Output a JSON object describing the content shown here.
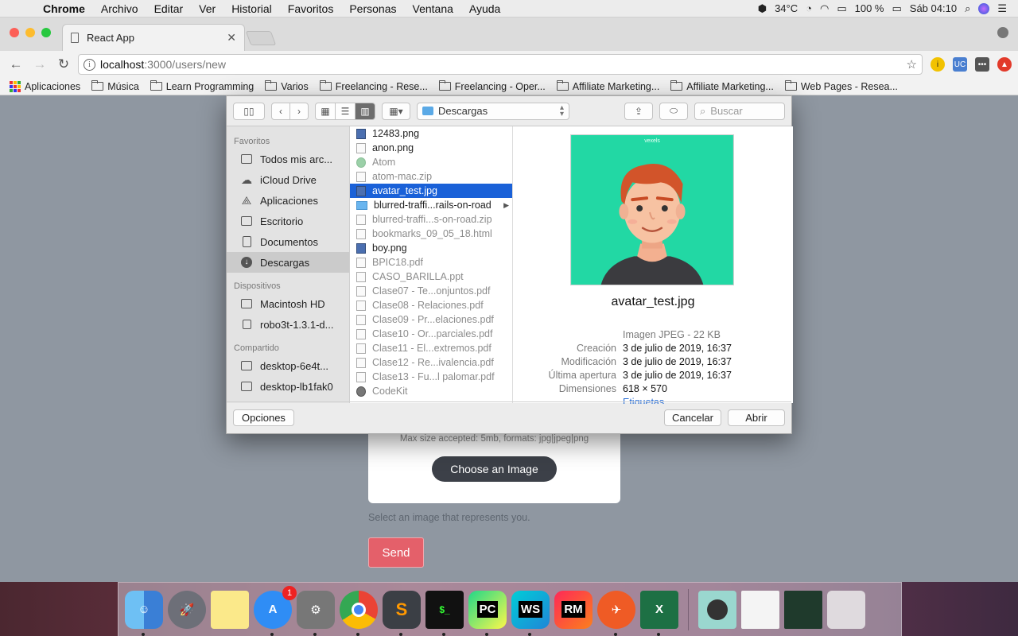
{
  "menubar": {
    "items": [
      "Chrome",
      "Archivo",
      "Editar",
      "Ver",
      "Historial",
      "Favoritos",
      "Personas",
      "Ventana",
      "Ayuda"
    ],
    "temperature": "34°C",
    "battery": "100 %",
    "clock": "Sáb 04:10"
  },
  "browser": {
    "tab_title": "React App",
    "url_host": "localhost",
    "url_path": ":3000/users/new",
    "extension_uc": "UC",
    "bookmarks": [
      "Aplicaciones",
      "Música",
      "Learn Programming",
      "Varios",
      "Freelancing - Rese...",
      "Freelancing - Oper...",
      "Affiliate Marketing...",
      "Affiliate Marketing...",
      "Web Pages - Resea..."
    ]
  },
  "page": {
    "card_note": "Max size accepted: 5mb, formats: jpg|jpeg|png",
    "choose_label": "Choose an Image",
    "hint": "Select an image that represents you.",
    "send_label": "Send"
  },
  "dialog": {
    "location": "Descargas",
    "search_placeholder": "Buscar",
    "sidebar": {
      "favoritos_label": "Favoritos",
      "favoritos": [
        "Todos mis arc...",
        "iCloud Drive",
        "Aplicaciones",
        "Escritorio",
        "Documentos",
        "Descargas"
      ],
      "dispositivos_label": "Dispositivos",
      "dispositivos": [
        "Macintosh HD",
        "robo3t-1.3.1-d..."
      ],
      "compartido_label": "Compartido",
      "compartido": [
        "desktop-6e4t...",
        "desktop-lb1fak0"
      ]
    },
    "files": [
      {
        "name": "12483.png",
        "kind": "img",
        "dim": false
      },
      {
        "name": "anon.png",
        "kind": "doc",
        "dim": false
      },
      {
        "name": "Atom",
        "kind": "atom",
        "dim": true
      },
      {
        "name": "atom-mac.zip",
        "kind": "doc",
        "dim": true
      },
      {
        "name": "avatar_test.jpg",
        "kind": "img",
        "dim": false,
        "selected": true
      },
      {
        "name": "blurred-traffi...rails-on-road",
        "kind": "folder",
        "dim": false,
        "chevron": true
      },
      {
        "name": "blurred-traffi...s-on-road.zip",
        "kind": "doc",
        "dim": true
      },
      {
        "name": "bookmarks_09_05_18.html",
        "kind": "doc",
        "dim": true
      },
      {
        "name": "boy.png",
        "kind": "img",
        "dim": false
      },
      {
        "name": "BPIC18.pdf",
        "kind": "doc",
        "dim": true
      },
      {
        "name": "CASO_BARILLA.ppt",
        "kind": "doc",
        "dim": true
      },
      {
        "name": "Clase07 - Te...onjuntos.pdf",
        "kind": "doc",
        "dim": true
      },
      {
        "name": "Clase08 - Relaciones.pdf",
        "kind": "doc",
        "dim": true
      },
      {
        "name": "Clase09 - Pr...elaciones.pdf",
        "kind": "doc",
        "dim": true
      },
      {
        "name": "Clase10 - Or...parciales.pdf",
        "kind": "doc",
        "dim": true
      },
      {
        "name": "Clase11 - El...extremos.pdf",
        "kind": "doc",
        "dim": true
      },
      {
        "name": "Clase12 - Re...ivalencia.pdf",
        "kind": "doc",
        "dim": true
      },
      {
        "name": "Clase13 - Fu...l palomar.pdf",
        "kind": "doc",
        "dim": true
      },
      {
        "name": "CodeKit",
        "kind": "ck",
        "dim": true
      }
    ],
    "preview": {
      "watermark": "vexels",
      "name": "avatar_test.jpg",
      "kind": "Imagen JPEG - 22 KB",
      "creacion_label": "Creación",
      "creacion": "3 de julio de 2019, 16:37",
      "modificacion_label": "Modificación",
      "modificacion": "3 de julio de 2019, 16:37",
      "ultima_label": "Última apertura",
      "ultima": "3 de julio de 2019, 16:37",
      "dimensiones_label": "Dimensiones",
      "dimensiones": "618 × 570",
      "etiquetas": "Etiquetas..."
    },
    "options_label": "Opciones",
    "cancel_label": "Cancelar",
    "open_label": "Abrir"
  },
  "dock": {
    "badge_count": "1",
    "apps": [
      "finder",
      "launchpad",
      "notes",
      "app-store",
      "system-preferences",
      "chrome",
      "sublime-text",
      "terminal",
      "pycharm",
      "webstorm",
      "rubymine",
      "postman",
      "excel"
    ]
  },
  "colors": {
    "selection": "#1a61d8",
    "send_button": "#e4606a",
    "choose_button": "#3c4048",
    "avatar_bg": "#22d8a4"
  }
}
